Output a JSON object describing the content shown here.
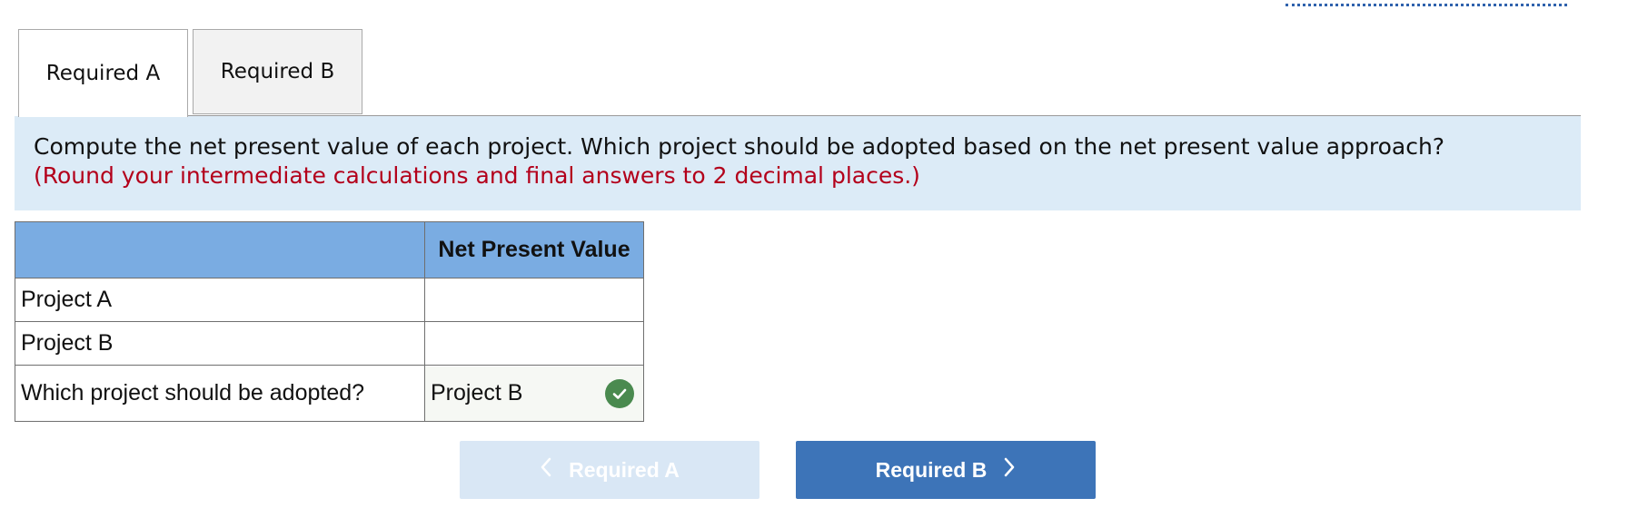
{
  "tabs": [
    {
      "label": "Required A",
      "active": true
    },
    {
      "label": "Required B",
      "active": false
    }
  ],
  "instructions": {
    "text": "Compute the net present value of each project. Which project should be adopted based on the net present value approach?",
    "note": "(Round your intermediate calculations and final answers to 2 decimal places.)"
  },
  "table": {
    "header_blank": "",
    "header_value": "Net Present Value",
    "rows": [
      {
        "label": "Project A",
        "value": ""
      },
      {
        "label": "Project B",
        "value": ""
      },
      {
        "label": "Which project should be adopted?",
        "value": "Project B"
      }
    ]
  },
  "status": {
    "answer_check": "correct"
  },
  "nav": {
    "prev_label": "Required A",
    "next_label": "Required B",
    "prev_icon": "chevron-left-icon",
    "next_icon": "chevron-right-icon"
  },
  "colors": {
    "instruction_bg": "#dcebf7",
    "note_red": "#b3001b",
    "header_blue": "#7aace2",
    "button_blue": "#3d74b8",
    "button_disabled": "#d9e7f5",
    "check_green": "#4a8a4f"
  }
}
